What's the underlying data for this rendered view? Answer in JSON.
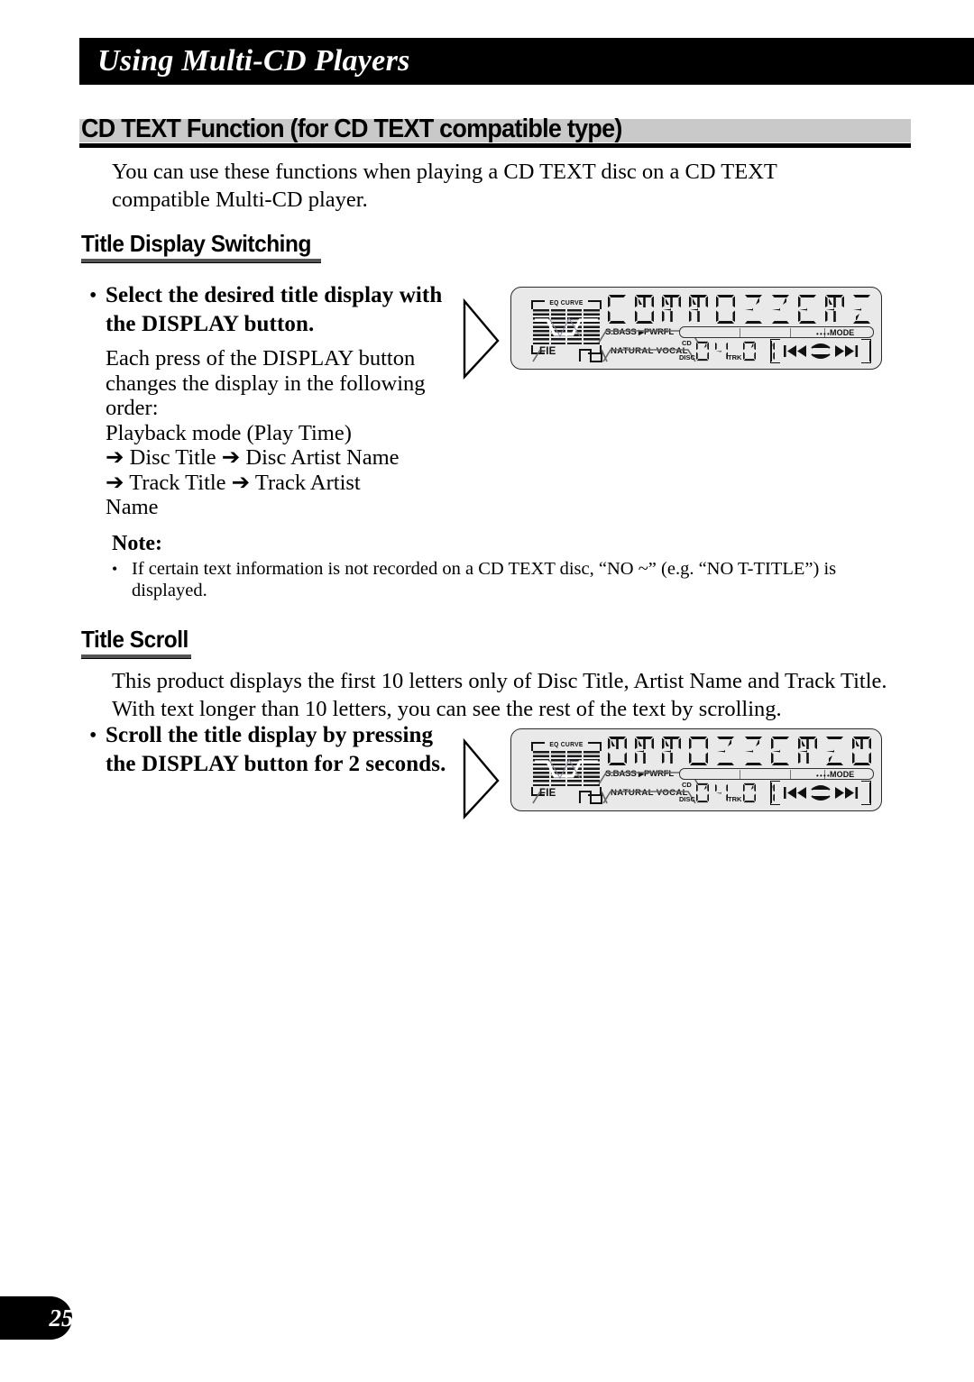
{
  "page": {
    "chapter_title": "Using Multi-CD Players",
    "page_number": "25"
  },
  "section": {
    "heading": "CD TEXT Function (for CD TEXT compatible type)",
    "intro": "You can use these functions when playing a CD TEXT disc on a CD TEXT compatible Multi-CD player."
  },
  "title_display_switching": {
    "heading": "Title Display Switching",
    "bullet_dot": "•",
    "instruction": "Select the desired title display with the DISPLAY button.",
    "description_line_1": "Each press of the DISPLAY button changes the display in the following order:",
    "description_line_2": "Playback mode (Play Time)",
    "description_line_3": "➔ Disc Title ➔ Disc Artist Name",
    "description_line_4": "➔ Track Title ➔ Track Artist",
    "description_line_5": "Name"
  },
  "note": {
    "label": "Note:",
    "bullet_dot": "•",
    "text": "If certain text information is not recorded on a CD TEXT disc, “NO ~” (e.g. “NO T-TITLE”) is displayed."
  },
  "title_scroll": {
    "heading": "Title Scroll",
    "paragraph": "This product displays the first 10 letters only of Disc Title, Artist Name and Track Title. With text longer than 10 letters, you can see the rest of the text by scrolling.",
    "bullet_dot": "•",
    "instruction": "Scroll the title display by pressing the DISPLAY button for 2 seconds."
  },
  "lcd_displays": [
    {
      "id": "lcd-display-1",
      "main_text": "CARROZZERI",
      "eq_curve_label": "EQ CURVE",
      "sbass_label": "S.BASS",
      "pwrfl_label": "PWRFL",
      "natural_label": "NATURAL",
      "vocal_label": "VOCAL",
      "fie_label": "FIE",
      "mode_label": "MODE",
      "mode_dots": "••••",
      "cd_label": "CD",
      "disc_label": "DISC",
      "disc_number": "04",
      "trk_label": "TRK",
      "track_number": "01",
      "prev_icon": "skip-back-icon",
      "next_icon": "skip-forward-icon"
    },
    {
      "id": "lcd-display-2",
      "main_text": "ARROZZERIA",
      "eq_curve_label": "EQ CURVE",
      "sbass_label": "S.BASS",
      "pwrfl_label": "PWRFL",
      "natural_label": "NATURAL",
      "vocal_label": "VOCAL",
      "fie_label": "FIE",
      "mode_label": "MODE",
      "mode_dots": "••••",
      "cd_label": "CD",
      "disc_label": "DISC",
      "disc_number": "04",
      "trk_label": "TRK",
      "track_number": "01",
      "prev_icon": "skip-back-icon",
      "next_icon": "skip-forward-icon"
    }
  ],
  "colors": {
    "header_bar": "#000000",
    "section_band": "#c9c9c9",
    "lcd_background": "#e9e9e9",
    "lcd_border": "#2a2a2a"
  }
}
